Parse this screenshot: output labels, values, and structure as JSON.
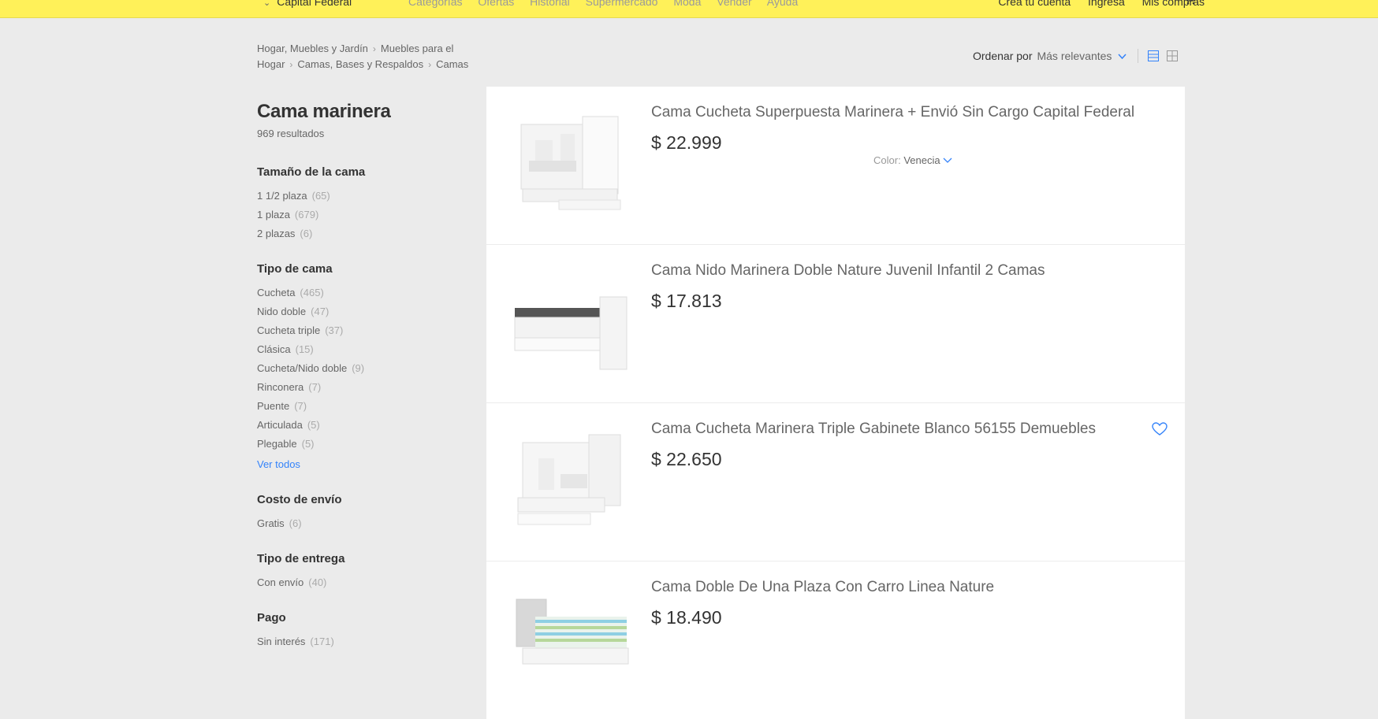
{
  "header": {
    "location": "Capital Federal",
    "nav": [
      "Categorías",
      "Ofertas",
      "Historial",
      "Supermercado",
      "Moda",
      "Vender",
      "Ayuda"
    ],
    "account": [
      "Creá tu cuenta",
      "Ingresá",
      "Mis compras"
    ]
  },
  "breadcrumb": [
    "Hogar, Muebles y Jardín",
    "Muebles para el Hogar",
    "Camas, Bases y Respaldos",
    "Camas"
  ],
  "search": {
    "title": "Cama marinera",
    "results": "969 resultados"
  },
  "sort": {
    "label": "Ordenar por",
    "value": "Más relevantes"
  },
  "filters": [
    {
      "title": "Tamaño de la cama",
      "items": [
        {
          "label": "1 1/2 plaza",
          "count": "(65)"
        },
        {
          "label": "1 plaza",
          "count": "(679)"
        },
        {
          "label": "2 plazas",
          "count": "(6)"
        }
      ]
    },
    {
      "title": "Tipo de cama",
      "items": [
        {
          "label": "Cucheta",
          "count": "(465)"
        },
        {
          "label": "Nido doble",
          "count": "(47)"
        },
        {
          "label": "Cucheta triple",
          "count": "(37)"
        },
        {
          "label": "Clásica",
          "count": "(15)"
        },
        {
          "label": "Cucheta/Nido doble",
          "count": "(9)"
        },
        {
          "label": "Rinconera",
          "count": "(7)"
        },
        {
          "label": "Puente",
          "count": "(7)"
        },
        {
          "label": "Articulada",
          "count": "(5)"
        },
        {
          "label": "Plegable",
          "count": "(5)"
        }
      ],
      "more": "Ver todos"
    },
    {
      "title": "Costo de envío",
      "items": [
        {
          "label": "Gratis",
          "count": "(6)"
        }
      ]
    },
    {
      "title": "Tipo de entrega",
      "items": [
        {
          "label": "Con envío",
          "count": "(40)"
        }
      ]
    },
    {
      "title": "Pago",
      "items": [
        {
          "label": "Sin interés",
          "count": "(171)"
        }
      ]
    }
  ],
  "products": [
    {
      "title": "Cama Cucheta Superpuesta Marinera + Envió Sin Cargo Capital Federal",
      "price": "$ 22.999",
      "color_label": "Color:",
      "color_value": "Venecia"
    },
    {
      "title": "Cama Nido Marinera Doble Nature Juvenil Infantil 2 Camas",
      "price": "$ 17.813"
    },
    {
      "title": "Cama Cucheta Marinera Triple Gabinete Blanco 56155 Demuebles",
      "price": "$ 22.650"
    },
    {
      "title": "Cama Doble De Una Plaza Con Carro Linea Nature",
      "price": "$ 18.490"
    }
  ],
  "icons": {
    "cart": "cart-icon",
    "sort_arrow": "chevron-down-icon",
    "list_view": "list-view-icon",
    "grid_view": "grid-view-icon",
    "favorite": "heart-icon"
  },
  "colors": {
    "header_bg": "#fff159",
    "page_bg": "#ebebeb",
    "link": "#3483fa"
  }
}
